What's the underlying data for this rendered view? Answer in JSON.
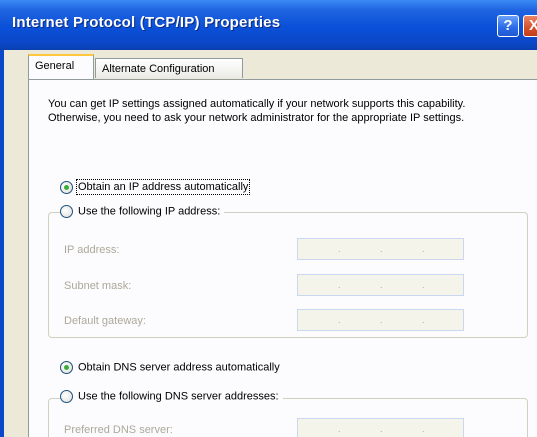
{
  "window": {
    "title": "Internet Protocol (TCP/IP) Properties",
    "help_glyph": "?",
    "close_glyph": "X"
  },
  "tabs": [
    {
      "label": "General",
      "active": true
    },
    {
      "label": "Alternate Configuration",
      "active": false
    }
  ],
  "description": "You can get IP settings assigned automatically if your network supports this capability. Otherwise, you need to ask your network administrator for the appropriate IP settings.",
  "ip": {
    "auto_label": "Obtain an IP address automatically",
    "manual_label": "Use the following IP address:",
    "selected": "auto",
    "fields": [
      {
        "label": "IP address:",
        "value": ""
      },
      {
        "label": "Subnet mask:",
        "value": ""
      },
      {
        "label": "Default gateway:",
        "value": ""
      }
    ]
  },
  "dns": {
    "auto_label": "Obtain DNS server address automatically",
    "manual_label": "Use the following DNS server addresses:",
    "selected": "auto",
    "fields": [
      {
        "label": "Preferred DNS server:",
        "value": ""
      }
    ]
  },
  "ip_separator": "."
}
